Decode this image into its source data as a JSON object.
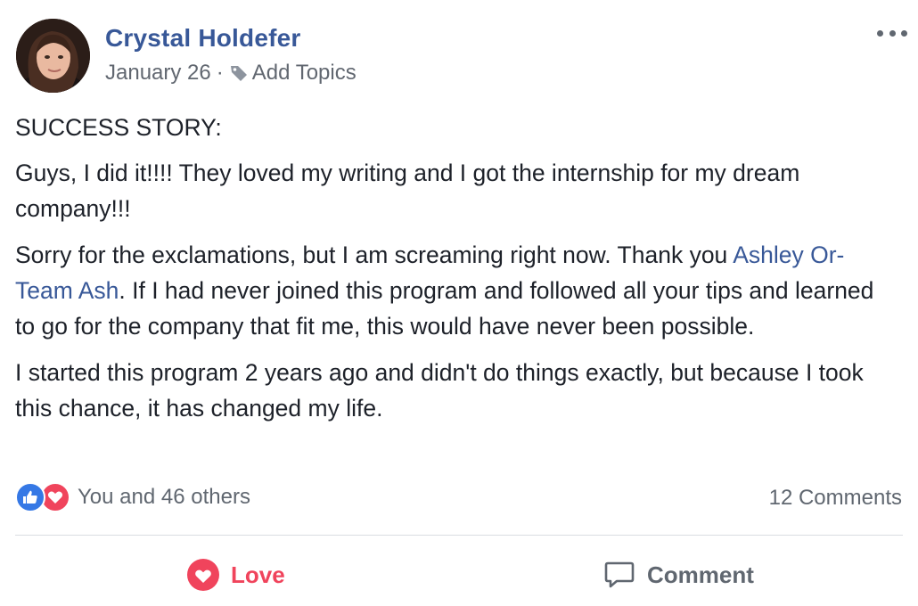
{
  "post": {
    "author": "Crystal Holdefer",
    "date": "January 26",
    "separator": "·",
    "topics_label": "Add Topics",
    "paragraphs": {
      "p1": "SUCCESS STORY:",
      "p2": "Guys, I did it!!!! They loved my writing and I got the internship for my dream company!!!",
      "p3_before": "Sorry for the exclamations, but I am screaming right now. Thank you ",
      "p3_mention": "Ashley Or-Team Ash",
      "p3_after": ". If I had never joined this program and followed all your tips and learned to go for the company that fit me, this would have never been possible.",
      "p4": "I started this program 2 years ago and didn't do things exactly, but because I took this chance, it has changed my life."
    }
  },
  "reactions": {
    "icons": [
      "like-icon",
      "love-icon"
    ],
    "count_text": "You and 46 others"
  },
  "comments_count": "12 Comments",
  "actions": {
    "love_label": "Love",
    "comment_label": "Comment"
  },
  "colors": {
    "link": "#385898",
    "love": "#f0445c",
    "like": "#3578e5",
    "meta": "#616770"
  }
}
